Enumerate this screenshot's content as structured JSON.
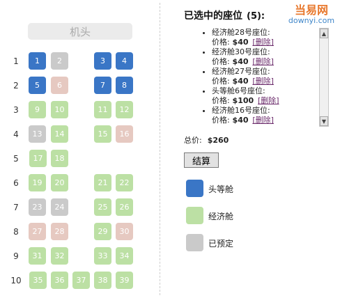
{
  "seat_map": {
    "cabin_head": "机头",
    "rows": [
      {
        "num": "1",
        "seats": [
          {
            "label": "1",
            "type": "first"
          },
          {
            "label": "2",
            "type": "booked"
          },
          {
            "label": "3",
            "type": "first"
          },
          {
            "label": "4",
            "type": "first"
          }
        ]
      },
      {
        "num": "2",
        "seats": [
          {
            "label": "5",
            "type": "first"
          },
          {
            "label": "6",
            "type": "selected"
          },
          {
            "label": "7",
            "type": "first"
          },
          {
            "label": "8",
            "type": "first"
          }
        ]
      },
      {
        "num": "3",
        "seats": [
          {
            "label": "9",
            "type": "economy"
          },
          {
            "label": "10",
            "type": "economy"
          },
          {
            "label": "11",
            "type": "economy"
          },
          {
            "label": "12",
            "type": "economy"
          }
        ]
      },
      {
        "num": "4",
        "seats": [
          {
            "label": "13",
            "type": "booked"
          },
          {
            "label": "14",
            "type": "economy"
          },
          {
            "label": "15",
            "type": "economy"
          },
          {
            "label": "16",
            "type": "selected"
          }
        ]
      },
      {
        "num": "5",
        "seats": [
          {
            "label": "17",
            "type": "economy"
          },
          {
            "label": "18",
            "type": "economy"
          }
        ]
      },
      {
        "num": "6",
        "seats": [
          {
            "label": "19",
            "type": "economy"
          },
          {
            "label": "20",
            "type": "economy"
          },
          {
            "label": "21",
            "type": "economy"
          },
          {
            "label": "22",
            "type": "economy"
          }
        ]
      },
      {
        "num": "7",
        "seats": [
          {
            "label": "23",
            "type": "booked"
          },
          {
            "label": "24",
            "type": "booked"
          },
          {
            "label": "25",
            "type": "economy"
          },
          {
            "label": "26",
            "type": "economy"
          }
        ]
      },
      {
        "num": "8",
        "seats": [
          {
            "label": "27",
            "type": "selected"
          },
          {
            "label": "28",
            "type": "selected"
          },
          {
            "label": "29",
            "type": "economy"
          },
          {
            "label": "30",
            "type": "selected"
          }
        ]
      },
      {
        "num": "9",
        "seats": [
          {
            "label": "31",
            "type": "economy"
          },
          {
            "label": "32",
            "type": "economy"
          },
          {
            "label": "33",
            "type": "economy"
          },
          {
            "label": "34",
            "type": "economy"
          }
        ]
      },
      {
        "num": "10",
        "seats": [
          {
            "label": "35",
            "type": "economy"
          },
          {
            "label": "36",
            "type": "economy"
          },
          {
            "label": "37",
            "type": "economy"
          },
          {
            "label": "38",
            "type": "economy"
          },
          {
            "label": "39",
            "type": "economy"
          }
        ]
      }
    ]
  },
  "panel": {
    "title": "已选中的座位",
    "count": "(5):",
    "selected_items": [
      {
        "seat": "经济舱28号座位:",
        "price_label": "价格:",
        "price": "$40",
        "delete": "[删除]"
      },
      {
        "seat": "经济舱30号座位:",
        "price_label": "价格:",
        "price": "$40",
        "delete": "[删除]"
      },
      {
        "seat": "经济舱27号座位:",
        "price_label": "价格:",
        "price": "$40",
        "delete": "[删除]"
      },
      {
        "seat": "头等舱6号座位:",
        "price_label": "价格:",
        "price": "$100",
        "delete": "[删除]"
      },
      {
        "seat": "经济舱16号座位:",
        "price_label": "价格:",
        "price": "$40",
        "delete": "[删除]"
      }
    ],
    "total_label": "总价:",
    "total_value": "$260",
    "checkout_label": "结算",
    "logo_line1": "当易网",
    "logo_line2": "downyi.com"
  },
  "legend": [
    {
      "label": "头等舱",
      "color": "#3a76c6"
    },
    {
      "label": "经济舱",
      "color": "#bce0a4"
    },
    {
      "label": "已预定",
      "color": "#cacaca"
    }
  ],
  "colors": {
    "first": "#3a76c6",
    "economy": "#bce0a4",
    "booked": "#cacaca",
    "selected": "#e6c9c1"
  }
}
